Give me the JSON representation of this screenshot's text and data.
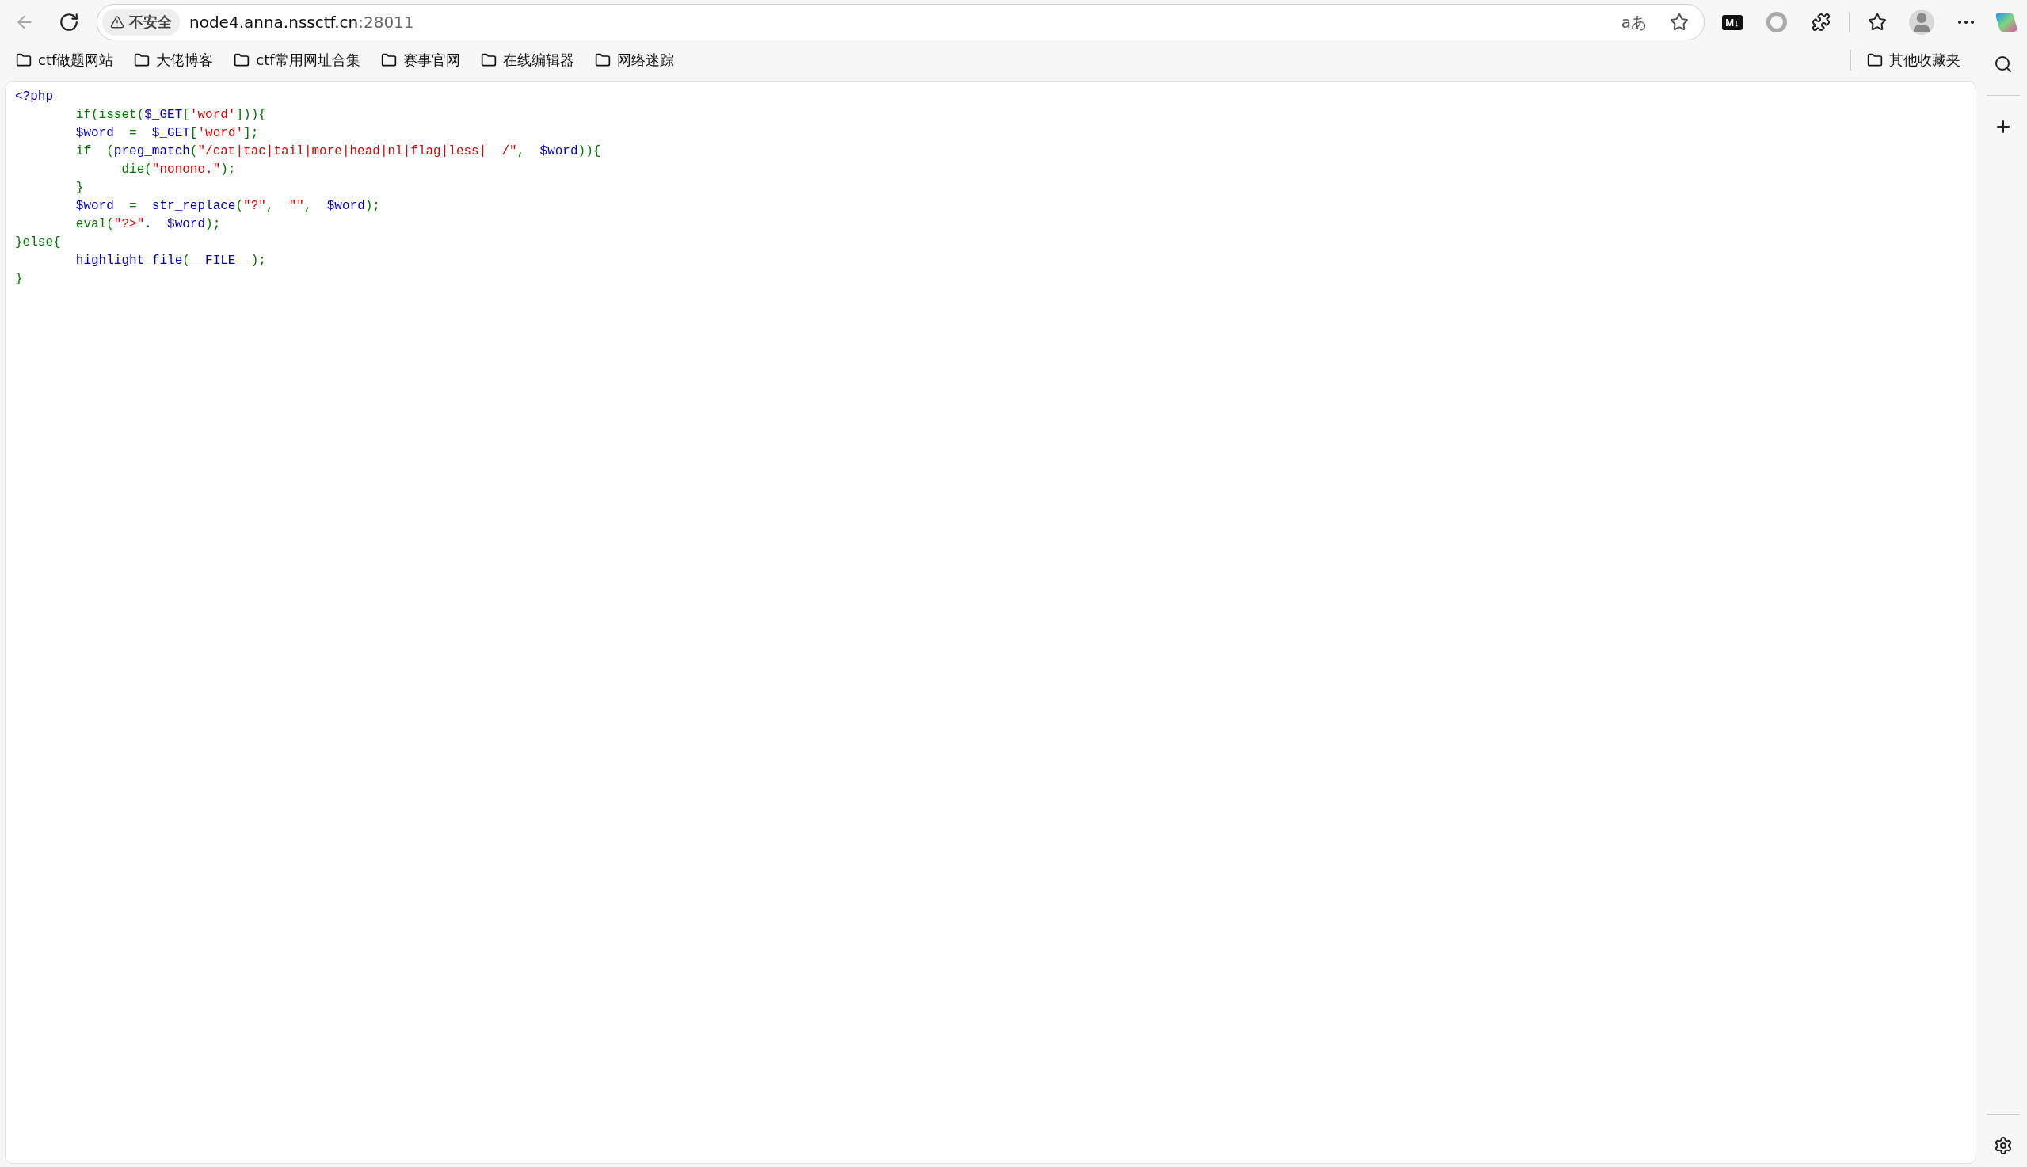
{
  "toolbar": {
    "security_label": "不安全",
    "url_host": "node4.anna.nssctf.cn",
    "url_port": ":28011",
    "translate_glyph": "aあ",
    "markdown_glyph": "M↓"
  },
  "bookmarks": [
    "ctf做题网站",
    "大佬博客",
    "ctf常用网址合集",
    "赛事官网",
    "在线编辑器",
    "网络迷踪"
  ],
  "other_bookmarks": "其他收藏夹",
  "code_lines": [
    {
      "tokens": [
        {
          "text": "<?php",
          "color": "#0000bb"
        }
      ]
    },
    {
      "tokens": [
        {
          "text": "        if(isset(",
          "color": "#007700"
        },
        {
          "text": "$_GET",
          "color": "#0000bb"
        },
        {
          "text": "[",
          "color": "#007700"
        },
        {
          "text": "'word'",
          "color": "#dd0000"
        },
        {
          "text": "])){",
          "color": "#007700"
        }
      ]
    },
    {
      "tokens": [
        {
          "text": "        $word  ",
          "color": "#0000bb"
        },
        {
          "text": "=  ",
          "color": "#007700"
        },
        {
          "text": "$_GET",
          "color": "#0000bb"
        },
        {
          "text": "[",
          "color": "#007700"
        },
        {
          "text": "'word'",
          "color": "#dd0000"
        },
        {
          "text": "];",
          "color": "#007700"
        }
      ]
    },
    {
      "tokens": [
        {
          "text": "        if  (",
          "color": "#007700"
        },
        {
          "text": "preg_match",
          "color": "#0000bb"
        },
        {
          "text": "(",
          "color": "#007700"
        },
        {
          "text": "\"/cat|tac|tail|more|head|nl|flag|less|  /\"",
          "color": "#dd0000"
        },
        {
          "text": ",  "
        },
        {
          "text": "$word",
          "color": "#0000bb"
        },
        {
          "text": ")){",
          "color": "#007700"
        }
      ]
    },
    {
      "tokens": [
        {
          "text": "              die(",
          "color": "#007700"
        },
        {
          "text": "\"nonono.\"",
          "color": "#dd0000"
        },
        {
          "text": ");",
          "color": "#007700"
        }
      ]
    },
    {
      "tokens": [
        {
          "text": "        }",
          "color": "#007700"
        }
      ]
    },
    {
      "tokens": [
        {
          "text": "        $word  ",
          "color": "#0000bb"
        },
        {
          "text": "=  ",
          "color": "#007700"
        },
        {
          "text": "str_replace",
          "color": "#0000bb"
        },
        {
          "text": "(",
          "color": "#007700"
        },
        {
          "text": "\"?\"",
          "color": "#dd0000"
        },
        {
          "text": ",  "
        },
        {
          "text": "\"\"",
          "color": "#dd0000"
        },
        {
          "text": ",  "
        },
        {
          "text": "$word",
          "color": "#0000bb"
        },
        {
          "text": ");",
          "color": "#007700"
        }
      ]
    },
    {
      "tokens": [
        {
          "text": "        eval(",
          "color": "#007700"
        },
        {
          "text": "\"?>\"",
          "color": "#dd0000"
        },
        {
          "text": ".  "
        },
        {
          "text": "$word",
          "color": "#0000bb"
        },
        {
          "text": ");",
          "color": "#007700"
        }
      ]
    },
    {
      "tokens": [
        {
          "text": "}else{",
          "color": "#007700"
        }
      ]
    },
    {
      "tokens": [
        {
          "text": "        highlight_file",
          "color": "#0000bb"
        },
        {
          "text": "(",
          "color": "#007700"
        },
        {
          "text": "__FILE__",
          "color": "#0000bb"
        },
        {
          "text": ");",
          "color": "#007700"
        }
      ]
    },
    {
      "tokens": [
        {
          "text": "}",
          "color": "#007700"
        }
      ]
    }
  ]
}
